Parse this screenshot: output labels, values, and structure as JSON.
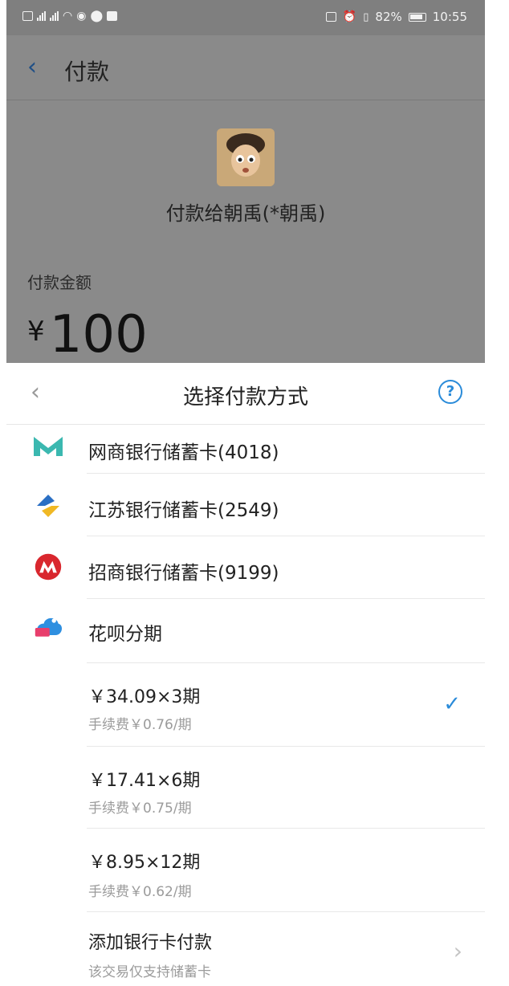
{
  "status_bar": {
    "battery": "82%",
    "time": "10:55"
  },
  "payment_page": {
    "title": "付款",
    "payee": "付款给朝禹(*朝禹)",
    "amount_label": "付款金额",
    "currency": "¥",
    "amount": "100"
  },
  "sheet": {
    "title": "选择付款方式",
    "methods": [
      {
        "label": "网商银行储蓄卡(4018)",
        "icon": "mybank-logo-icon"
      },
      {
        "label": "江苏银行储蓄卡(2549)",
        "icon": "jiangsu-bank-logo-icon"
      },
      {
        "label": "招商银行储蓄卡(9199)",
        "icon": "cmb-logo-icon"
      },
      {
        "label": "花呗分期",
        "icon": "huabei-logo-icon"
      }
    ],
    "installments": [
      {
        "main": "￥34.09×3期",
        "fee": "手续费￥0.76/期",
        "selected": true
      },
      {
        "main": "￥17.41×6期",
        "fee": "手续费￥0.75/期",
        "selected": false
      },
      {
        "main": "￥8.95×12期",
        "fee": "手续费￥0.62/期",
        "selected": false
      }
    ],
    "add_card": {
      "label": "添加银行卡付款",
      "note": "该交易仅支持储蓄卡"
    }
  },
  "colors": {
    "accent": "#2a8bd9",
    "overlay_gray": "#8a8a8a"
  }
}
